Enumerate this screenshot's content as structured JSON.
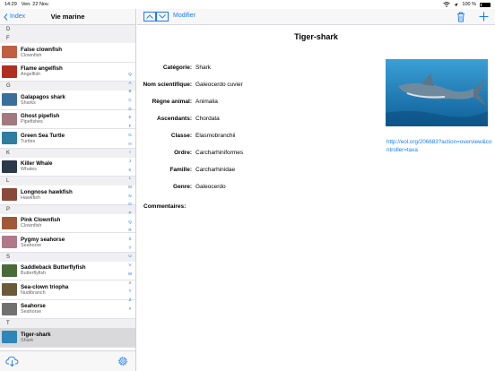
{
  "status": {
    "time": "14:29",
    "date": "Ven. 22 Nov.",
    "battery": "100 %"
  },
  "sidebar": {
    "back_label": "Index",
    "title": "Vie marine",
    "sections": [
      {
        "letter": "D",
        "items": []
      },
      {
        "letter": "F",
        "items": [
          {
            "name": "False clownfish",
            "category": "Clownfish",
            "thumb": "#c06040"
          },
          {
            "name": "Flame angelfish",
            "category": "Angelfish",
            "thumb": "#b03020"
          }
        ]
      },
      {
        "letter": "G",
        "items": [
          {
            "name": "Galapagos shark",
            "category": "Sharks",
            "thumb": "#3a6f9a"
          },
          {
            "name": "Ghost pipefish",
            "category": "Pipefishes",
            "thumb": "#a07a80"
          },
          {
            "name": "Green Sea Turtle",
            "category": "Turtles",
            "thumb": "#2e7ea0"
          }
        ]
      },
      {
        "letter": "K",
        "items": [
          {
            "name": "Killer Whale",
            "category": "Whales",
            "thumb": "#2a3a4a"
          }
        ]
      },
      {
        "letter": "L",
        "items": [
          {
            "name": "Longnose hawkfish",
            "category": "Hawkfish",
            "thumb": "#8a4a3a"
          }
        ]
      },
      {
        "letter": "P",
        "items": [
          {
            "name": "Pink Clownfish",
            "category": "Clownfish",
            "thumb": "#a05838"
          },
          {
            "name": "Pygmy seahorse",
            "category": "Seahorse",
            "thumb": "#b07888"
          }
        ]
      },
      {
        "letter": "S",
        "items": [
          {
            "name": "Saddleback Butterflyfish",
            "category": "Butterflyfish",
            "thumb": "#4a6a3a"
          },
          {
            "name": "Sea-clown triopha",
            "category": "Nudibranch",
            "thumb": "#6a5a3a"
          },
          {
            "name": "Seahorse",
            "category": "Seahorse",
            "thumb": "#707070"
          }
        ]
      },
      {
        "letter": "T",
        "items": [
          {
            "name": "Tiger-shark",
            "category": "Shark",
            "thumb": "#2f86b8",
            "selected": true
          }
        ]
      }
    ],
    "index_letters": [
      "Q",
      "A",
      "B",
      "C",
      "D",
      "E",
      "F",
      "G",
      "H",
      "I",
      "J",
      "K",
      "L",
      "M",
      "N",
      "O",
      "P",
      "Q",
      "R",
      "S",
      "T",
      "U",
      "V",
      "W",
      "X",
      "Y",
      "Z",
      "#"
    ]
  },
  "toolbar": {
    "modify_label": "Modifier"
  },
  "detail": {
    "title": "Tiger-shark",
    "fields": [
      {
        "label": "Catégorie:",
        "value": "Shark"
      },
      {
        "label": "Nom scientifique:",
        "value": "Galeocerdo cuvier"
      },
      {
        "label": "Règne animal:",
        "value": "Animalia"
      },
      {
        "label": "Ascendants:",
        "value": "Chordata"
      },
      {
        "label": "Classe:",
        "value": "Elasmobranchii"
      },
      {
        "label": "Ordre:",
        "value": "Carcharhiniformes"
      },
      {
        "label": "Famille:",
        "value": "Carcharhinidae"
      },
      {
        "label": "Genre:",
        "value": "Galeocerdo"
      }
    ],
    "comments_label": "Commentaires:",
    "link": "http://eol.org/206683?action=overview&controller=taxa"
  },
  "colors": {
    "accent": "#1a7cf5",
    "selected_row": "#d9d9dc"
  }
}
